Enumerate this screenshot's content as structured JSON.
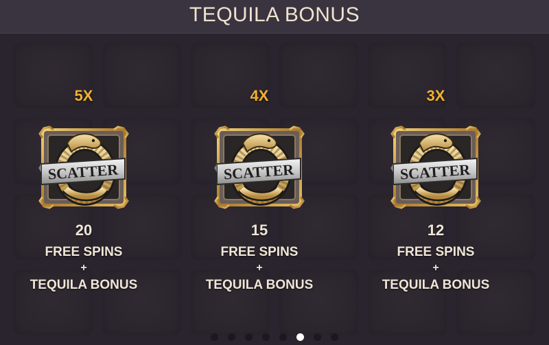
{
  "header": {
    "title": "TEQUILA BONUS"
  },
  "symbol": {
    "icon": "scatter-snake-icon",
    "label": "SCATTER"
  },
  "awards": [
    {
      "multiplier": "5X",
      "count": "20",
      "spins_label": "FREE SPINS",
      "plus": "+",
      "bonus_label": "TEQUILA BONUS"
    },
    {
      "multiplier": "4X",
      "count": "15",
      "spins_label": "FREE SPINS",
      "plus": "+",
      "bonus_label": "TEQUILA BONUS"
    },
    {
      "multiplier": "3X",
      "count": "12",
      "spins_label": "FREE SPINS",
      "plus": "+",
      "bonus_label": "TEQUILA BONUS"
    }
  ],
  "pagination": {
    "total_pages": 8,
    "active_page": 6
  },
  "colors": {
    "multiplier": "#f2b230",
    "text": "#efe6d6",
    "title": "#efe3cf",
    "active_dot": "#ffffff",
    "inactive_dot": "#1c181e"
  }
}
